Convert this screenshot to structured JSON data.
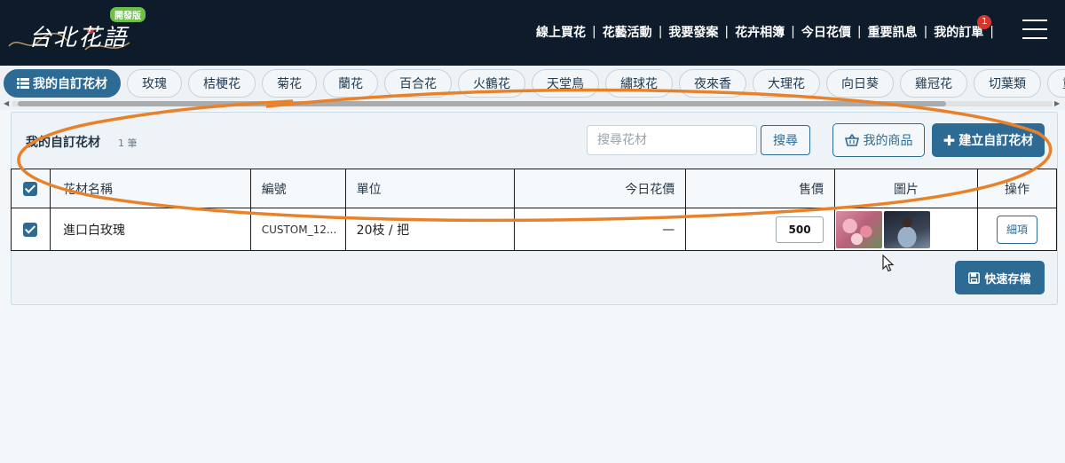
{
  "header": {
    "logo_text": "台北花語",
    "logo_badge": "開發版",
    "nav": [
      {
        "label": "線上買花"
      },
      {
        "label": "花藝活動"
      },
      {
        "label": "我要發案"
      },
      {
        "label": "花卉相簿"
      },
      {
        "label": "今日花價"
      },
      {
        "label": "重要訊息"
      },
      {
        "label": "我的訂單",
        "badge": "1"
      }
    ],
    "menu_icon": "hamburger-icon"
  },
  "categories": {
    "active_label": "我的自訂花材",
    "active_icon": "list-icon",
    "items": [
      "玫瑰",
      "桔梗花",
      "菊花",
      "蘭花",
      "百合花",
      "火鶴花",
      "天堂鳥",
      "繡球花",
      "夜來香",
      "大理花",
      "向日葵",
      "雞冠花",
      "切葉類",
      "重量計"
    ]
  },
  "panel": {
    "title": "我的自訂花材",
    "count": "1 筆",
    "search_placeholder": "搜尋花材",
    "search_button": "搜尋",
    "my_products_button": "我的商品",
    "create_button": "建立自訂花材",
    "save_button": "快速存檔"
  },
  "table": {
    "headers": {
      "name": "花材名稱",
      "code": "編號",
      "unit": "單位",
      "today_price": "今日花價",
      "sale_price": "售價",
      "image": "圖片",
      "action": "操作"
    },
    "rows": [
      {
        "checked": true,
        "name": "進口白玫瑰",
        "code": "CUSTOM_12...",
        "unit": "20枝 / 把",
        "today_price": "—",
        "sale_price": "500",
        "detail_button": "細項"
      }
    ]
  },
  "colors": {
    "header_bg": "#0d1b2a",
    "accent": "#2d6b95",
    "annotation": "#e8822a",
    "badge_red": "#d9362b",
    "badge_green": "#6cc04a"
  }
}
